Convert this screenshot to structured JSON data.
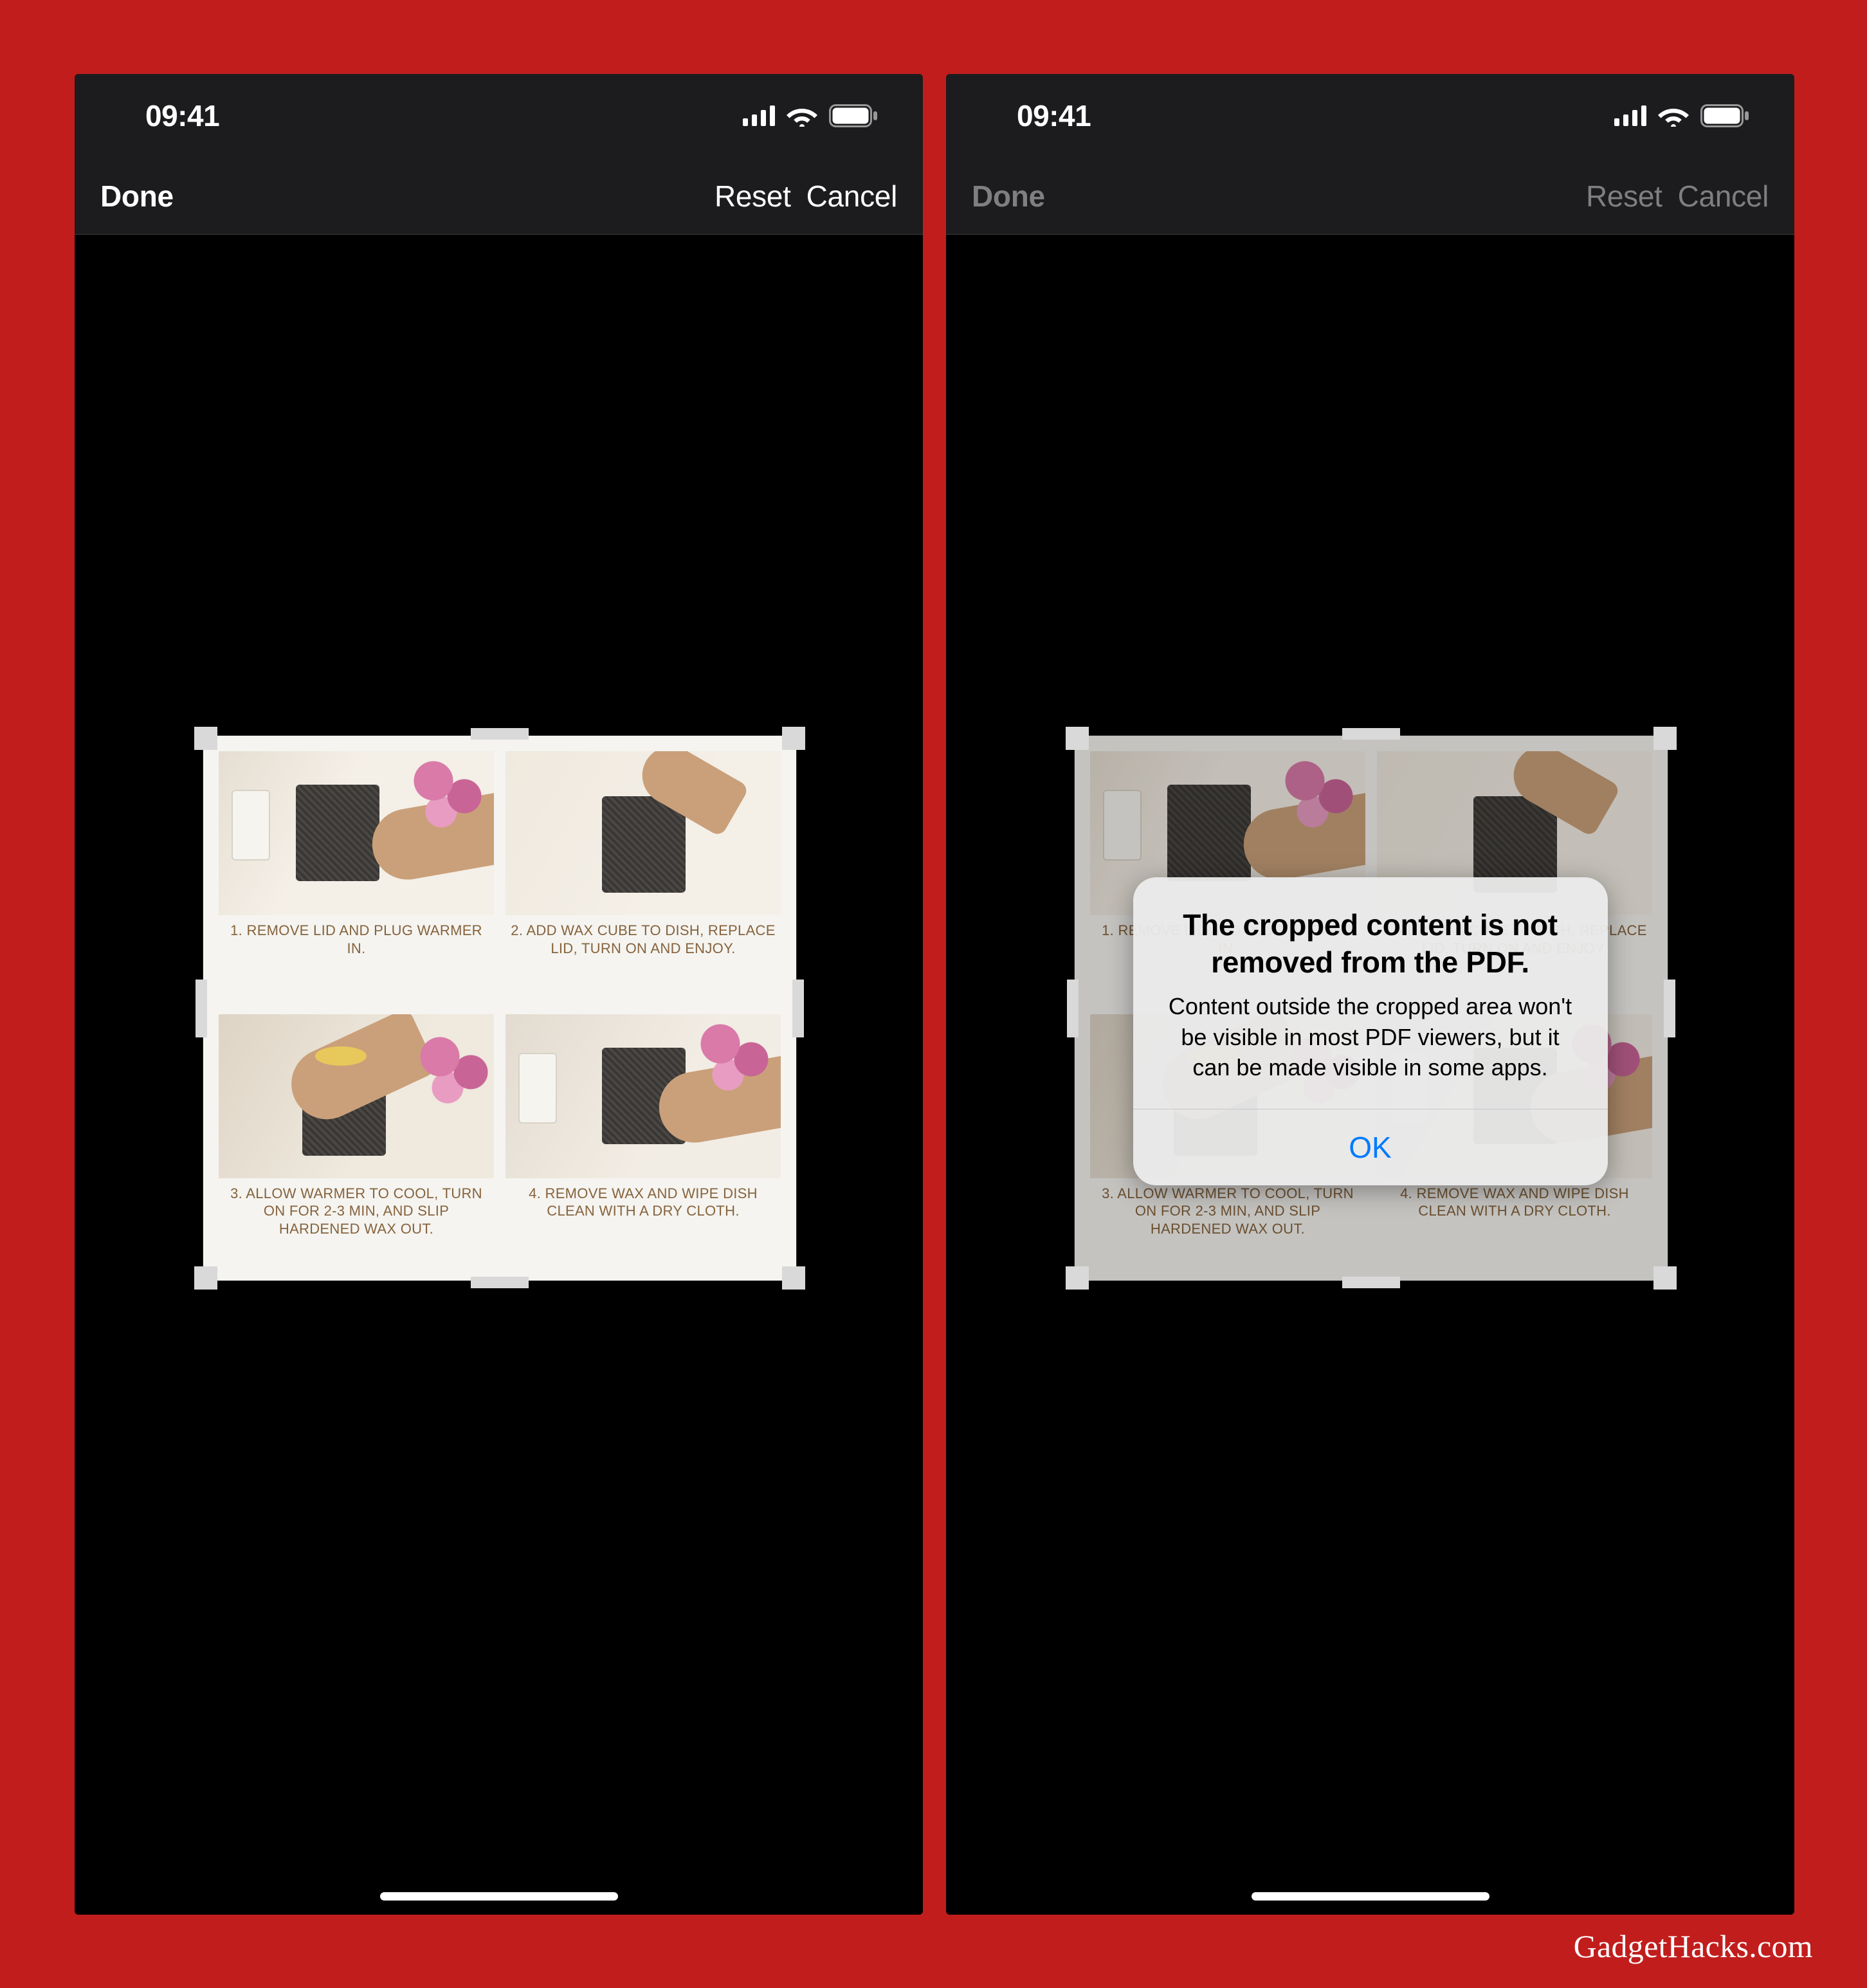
{
  "status": {
    "time": "09:41"
  },
  "nav": {
    "done": "Done",
    "reset": "Reset",
    "cancel": "Cancel"
  },
  "instructions": {
    "steps": [
      {
        "num": "1.",
        "text": "REMOVE LID AND PLUG WARMER IN."
      },
      {
        "num": "2.",
        "text": "ADD WAX CUBE TO DISH, REPLACE LID, TURN ON AND ENJOY."
      },
      {
        "num": "3.",
        "text": "ALLOW WARMER TO COOL, TURN ON FOR 2-3 MIN, AND SLIP HARDENED WAX OUT."
      },
      {
        "num": "4.",
        "text": "REMOVE WAX AND WIPE DISH CLEAN WITH A DRY CLOTH."
      }
    ]
  },
  "alert": {
    "title": "The cropped content is not removed from the PDF.",
    "message": "Content outside the cropped area won't be visible in most PDF viewers, but it can be made visible in some apps.",
    "ok": "OK"
  },
  "watermark": "GadgetHacks.com"
}
